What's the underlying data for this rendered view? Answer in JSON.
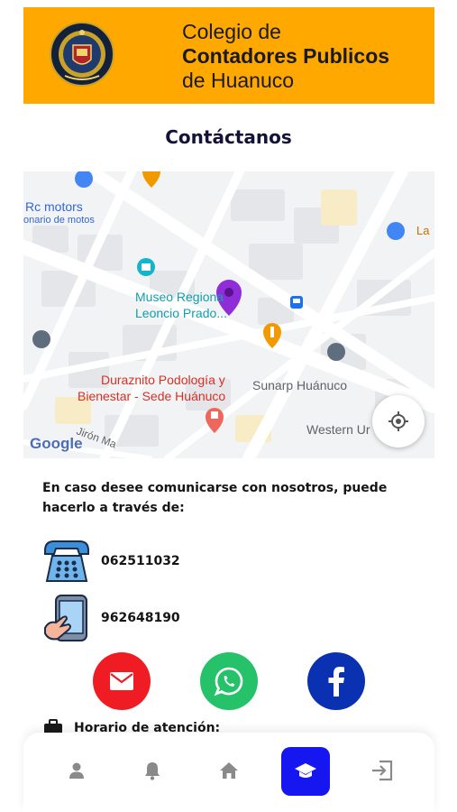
{
  "header": {
    "line1": "Colegio de",
    "line2": "Contadores Publicos",
    "line3": "de Huanuco",
    "seal_text": "COLEGIO DE CONTADORES PUBLICOS DE HUANUCO"
  },
  "page": {
    "title": "Contáctanos"
  },
  "map": {
    "labels": {
      "rc_motors": "Rc motors",
      "rc_motors_sub": "onario de motos",
      "museo_1": "Museo Regiona",
      "museo_2": "Leoncio Prado...",
      "duraznito_1": "Duraznito Podología y",
      "duraznito_2": "Bienestar - Sede Huánuco",
      "sunarp": "Sunarp Huánuco",
      "western": "Western Ur",
      "la": "La",
      "street": "Jirón Ma",
      "google": "Google"
    }
  },
  "contact": {
    "intro": "En caso desee comunicarse con nosotros, puede hacerlo a través de:",
    "phone": "062511032",
    "mobile": "962648190"
  },
  "hours": {
    "label": "Horario de atención:"
  },
  "colors": {
    "header_bg": "#ffa800",
    "email_btn": "#ef1c24",
    "whatsapp_btn": "#25c26a",
    "facebook_btn": "#0b31b3",
    "nav_active": "#1616f0"
  }
}
